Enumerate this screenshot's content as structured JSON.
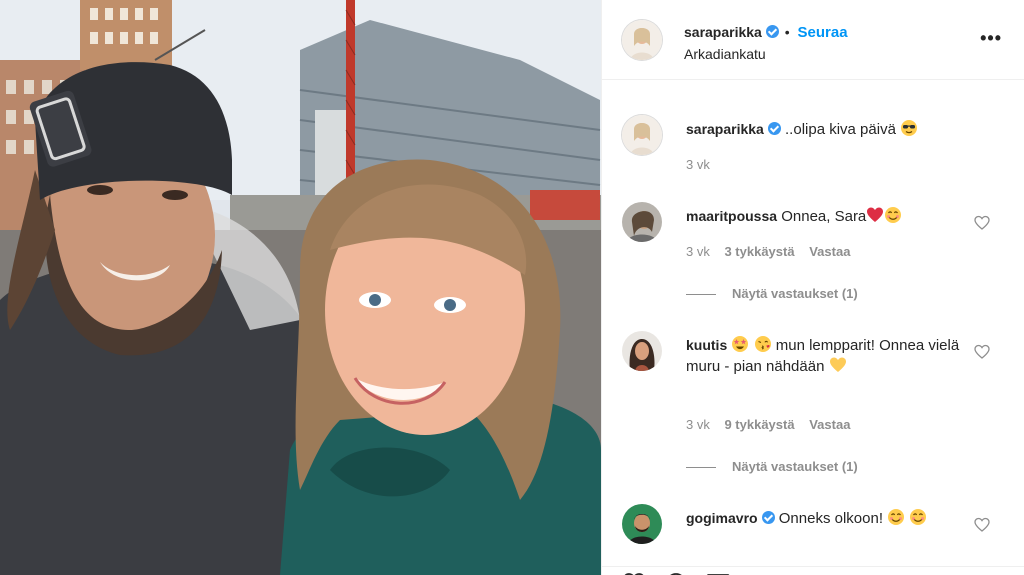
{
  "post": {
    "header": {
      "username": "saraparikka",
      "verified": true,
      "follow_label": "Seuraa",
      "separator": "•",
      "location": "Arkadiankatu",
      "more_label": "•••"
    },
    "caption": {
      "username": "saraparikka",
      "text": "..olipa kiva päivä",
      "time": "3 vk"
    },
    "comments": [
      {
        "username": "maaritpoussa",
        "text": "Onnea, Sara",
        "time": "3 vk",
        "likes": "3 tykkäystä",
        "reply_label": "Vastaa",
        "view_replies": "Näytä vastaukset (1)"
      },
      {
        "username": "kuutis",
        "text": "mun lempparit! Onnea vielä muru - pian nähdään",
        "time": "3 vk",
        "likes": "9 tykkäystä",
        "reply_label": "Vastaa",
        "view_replies": "Näytä vastaukset (1)"
      },
      {
        "username": "gogimavro",
        "verified": true,
        "text": "Onneks olkoon!",
        "time": "",
        "likes": ""
      }
    ],
    "colors": {
      "link_blue": "#0095f6",
      "verified_blue": "#3897f0",
      "muted_text": "#8e8e8e",
      "primary_text": "#262626",
      "heart_red": "#ed4956",
      "emoji_yellow": "#ffcc4d"
    },
    "icons": [
      "verified-badge-icon",
      "more-options-icon",
      "heart-outline-icon",
      "red-heart-emoji",
      "smiling-face-emoji",
      "yellow-heart-emoji",
      "star-eyes-emoji",
      "kiss-emoji",
      "sunglasses-emoji"
    ]
  }
}
